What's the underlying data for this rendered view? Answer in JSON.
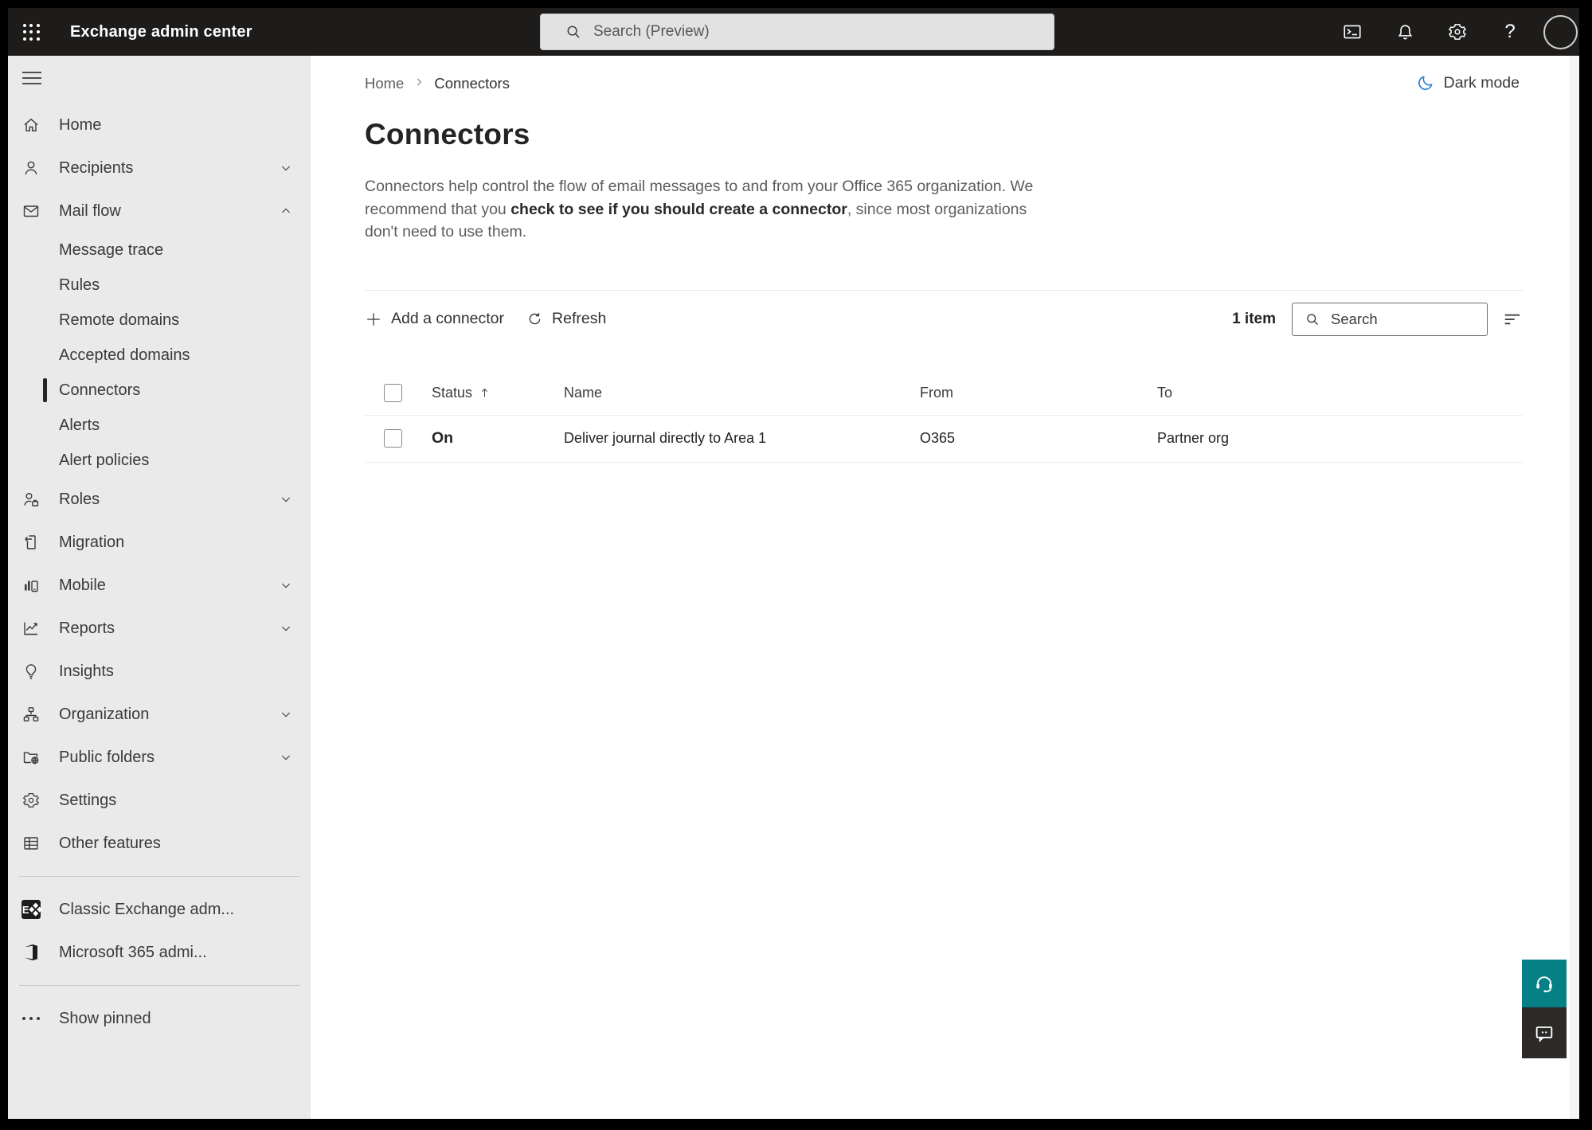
{
  "topbar": {
    "app_title": "Exchange admin center",
    "search_placeholder": "Search (Preview)",
    "icons": [
      "app-launcher-icon",
      "terminal-icon",
      "bell-icon",
      "gear-icon",
      "help-icon",
      "avatar"
    ]
  },
  "sidebar": {
    "items": [
      {
        "label": "Home",
        "icon": "home-icon",
        "level": 1
      },
      {
        "label": "Recipients",
        "icon": "person-icon",
        "level": 1,
        "chevron": "down"
      },
      {
        "label": "Mail flow",
        "icon": "mail-icon",
        "level": 1,
        "chevron": "up",
        "expanded": true
      },
      {
        "label": "Message trace",
        "level": 2
      },
      {
        "label": "Rules",
        "level": 2
      },
      {
        "label": "Remote domains",
        "level": 2
      },
      {
        "label": "Accepted domains",
        "level": 2
      },
      {
        "label": "Connectors",
        "level": 2,
        "selected": true
      },
      {
        "label": "Alerts",
        "level": 2
      },
      {
        "label": "Alert policies",
        "level": 2
      },
      {
        "label": "Roles",
        "icon": "person-badge-icon",
        "level": 1,
        "chevron": "down"
      },
      {
        "label": "Migration",
        "icon": "migration-icon",
        "level": 1
      },
      {
        "label": "Mobile",
        "icon": "mobile-chart-icon",
        "level": 1,
        "chevron": "down"
      },
      {
        "label": "Reports",
        "icon": "line-chart-icon",
        "level": 1,
        "chevron": "down"
      },
      {
        "label": "Insights",
        "icon": "lightbulb-icon",
        "level": 1
      },
      {
        "label": "Organization",
        "icon": "org-chart-icon",
        "level": 1,
        "chevron": "down"
      },
      {
        "label": "Public folders",
        "icon": "folder-globe-icon",
        "level": 1,
        "chevron": "down"
      },
      {
        "label": "Settings",
        "icon": "gear-icon",
        "level": 1
      },
      {
        "label": "Other features",
        "icon": "table-icon",
        "level": 1
      },
      {
        "label": "Classic Exchange adm...",
        "icon": "exchange-logo",
        "level": 1
      },
      {
        "label": "Microsoft 365 admi...",
        "icon": "microsoft-365-logo",
        "level": 1
      },
      {
        "label": "Show pinned",
        "icon": "ellipsis-icon",
        "level": 1
      }
    ]
  },
  "breadcrumb": {
    "home": "Home",
    "current": "Connectors"
  },
  "dark_mode": {
    "label": "Dark mode",
    "icon": "moon-icon",
    "icon_color": "#2f7fd4"
  },
  "page": {
    "title": "Connectors",
    "description_part1": "Connectors help control the flow of email messages to and from your Office 365 organization. We recommend that you ",
    "description_link": "check to see if you should create a connector",
    "description_part2": ", since most organizations don't need to use them."
  },
  "toolbar": {
    "add_label": "Add a connector",
    "refresh_label": "Refresh",
    "item_count": "1 item",
    "search_placeholder": "Search",
    "icons": [
      "plus-icon",
      "refresh-icon",
      "search-icon",
      "filter-icon"
    ]
  },
  "table": {
    "headers": {
      "status": "Status",
      "name": "Name",
      "from": "From",
      "to": "To"
    },
    "sort": {
      "column": "Status",
      "direction": "ascending"
    },
    "rows": [
      {
        "status": "On",
        "name": "Deliver journal directly to Area 1",
        "from": "O365",
        "to": "Partner org"
      }
    ]
  },
  "floating_buttons": {
    "help_icon": "headset-icon",
    "feedback_icon": "feedback-bubble-icon"
  },
  "colors": {
    "topbar_bg": "#1d1c1b",
    "sidebar_bg": "#ebeaea",
    "main_bg": "#ffffff",
    "accent_teal": "#068085",
    "feedback_dark": "#2b2a28",
    "moon_blue": "#2f7fd4",
    "text_dark": "#242424",
    "text_muted": "#5d5c5b"
  }
}
